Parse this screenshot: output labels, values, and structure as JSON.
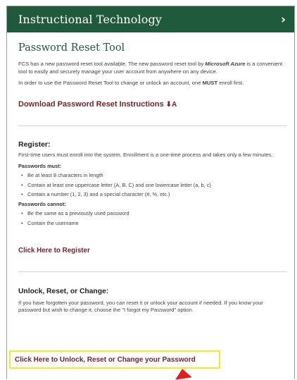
{
  "header": {
    "title": "Instructional Technology",
    "chevron": "›"
  },
  "page": {
    "title": "Password Reset Tool",
    "intro_part1": "FCS has a new password reset tool available. The new password reset tool by ",
    "intro_emph": "Microsoft Azure",
    "intro_part2": " is a convenient tool to easily and securely manage your user account from anywhere on any device.",
    "enroll_part1": "In order to use the Password Reset Tool to change or unlock an account, one ",
    "enroll_emph": "MUST",
    "enroll_part2": " enroll first."
  },
  "download": {
    "label": "Download Password Reset Instructions",
    "icon_glyph": "⬇A",
    "icon": "download-sort-icon"
  },
  "register": {
    "heading": "Register:",
    "description": "First-time users must enroll into the system. Enrollment is a one-time process and takes only a few minutes.",
    "must_heading": "Passwords must:",
    "must_items": [
      "Be at least 8 characters in length",
      "Contain at least one uppercase letter (A, B, C) and one lowercase letter (a, b, c)",
      "Contain a number (1, 2, 3) and a special character (#, %, etc.)"
    ],
    "cannot_heading": "Passwords cannot:",
    "cannot_items": [
      "Be the same as a previously used password",
      "Contain the username"
    ],
    "link_label": "Click Here to Register"
  },
  "unlock": {
    "heading": "Unlock, Reset, or Change:",
    "description": "If you have forgotten your password, you can reset it or unlock your account if needed. If you know your password but wish to change it, choose the \"I forgot my Password\" option.",
    "link_label": "Click Here to Unlock, Reset or Change your Password"
  },
  "colors": {
    "header_bg": "#1f5a3c",
    "link": "#7a1f2b",
    "highlight": "#f2ec2a",
    "cursor": "#e21e1e"
  }
}
